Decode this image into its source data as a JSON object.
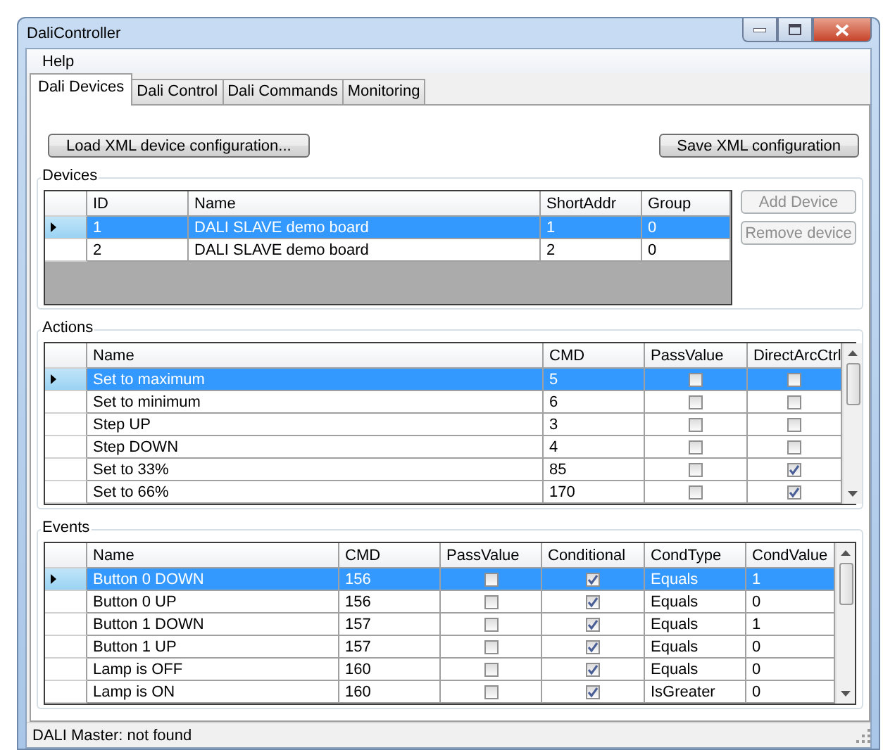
{
  "window": {
    "title": "DaliController"
  },
  "menu": [
    {
      "label": "Help"
    }
  ],
  "tabs": [
    {
      "label": "Dali Devices",
      "selected": true
    },
    {
      "label": "Dali Control",
      "selected": false
    },
    {
      "label": "Dali Commands",
      "selected": false
    },
    {
      "label": "Monitoring",
      "selected": false
    }
  ],
  "top_buttons": [
    {
      "label": "Load XML device configuration..."
    },
    {
      "label": "Save XML configuration"
    }
  ],
  "devices": {
    "title": "Devices",
    "columns": [
      {
        "label": "ID",
        "kind": "text"
      },
      {
        "label": "Name",
        "kind": "text"
      },
      {
        "label": "ShortAddr",
        "kind": "text"
      },
      {
        "label": "Group",
        "kind": "text"
      }
    ],
    "rows": [
      {
        "selected": true,
        "cells": [
          "1",
          "DALI SLAVE demo board",
          "1",
          "0"
        ]
      },
      {
        "selected": false,
        "cells": [
          "2",
          "DALI SLAVE demo board",
          "2",
          "0"
        ]
      }
    ],
    "buttons": [
      {
        "label": "Add Device",
        "disabled": true
      },
      {
        "label": "Remove device",
        "disabled": true
      }
    ]
  },
  "actions": {
    "title": "Actions",
    "columns": [
      {
        "label": "Name",
        "kind": "text"
      },
      {
        "label": "CMD",
        "kind": "text"
      },
      {
        "label": "PassValue",
        "kind": "check"
      },
      {
        "label": "DirectArcCtrl",
        "kind": "check"
      }
    ],
    "rows": [
      {
        "selected": true,
        "cells": [
          "Set to maximum",
          "5",
          false,
          false
        ]
      },
      {
        "selected": false,
        "cells": [
          "Set to minimum",
          "6",
          false,
          false
        ]
      },
      {
        "selected": false,
        "cells": [
          "Step UP",
          "3",
          false,
          false
        ]
      },
      {
        "selected": false,
        "cells": [
          "Step DOWN",
          "4",
          false,
          false
        ]
      },
      {
        "selected": false,
        "cells": [
          "Set to 33%",
          "85",
          false,
          true
        ]
      },
      {
        "selected": false,
        "cells": [
          "Set to 66%",
          "170",
          false,
          true
        ]
      }
    ]
  },
  "events": {
    "title": "Events",
    "columns": [
      {
        "label": "Name",
        "kind": "text"
      },
      {
        "label": "CMD",
        "kind": "text"
      },
      {
        "label": "PassValue",
        "kind": "check"
      },
      {
        "label": "Conditional",
        "kind": "check"
      },
      {
        "label": "CondType",
        "kind": "text"
      },
      {
        "label": "CondValue",
        "kind": "text"
      }
    ],
    "rows": [
      {
        "selected": true,
        "cells": [
          "Button 0 DOWN",
          "156",
          false,
          true,
          "Equals",
          "1"
        ]
      },
      {
        "selected": false,
        "cells": [
          "Button 0 UP",
          "156",
          false,
          true,
          "Equals",
          "0"
        ]
      },
      {
        "selected": false,
        "cells": [
          "Button 1 DOWN",
          "157",
          false,
          true,
          "Equals",
          "1"
        ]
      },
      {
        "selected": false,
        "cells": [
          "Button 1 UP",
          "157",
          false,
          true,
          "Equals",
          "0"
        ]
      },
      {
        "selected": false,
        "cells": [
          "Lamp is OFF",
          "160",
          false,
          true,
          "Equals",
          "0"
        ]
      },
      {
        "selected": false,
        "cells": [
          "Lamp is ON",
          "160",
          false,
          true,
          "IsGreater",
          "0"
        ]
      }
    ]
  },
  "status_bar": {
    "text": "DALI Master: not found"
  }
}
